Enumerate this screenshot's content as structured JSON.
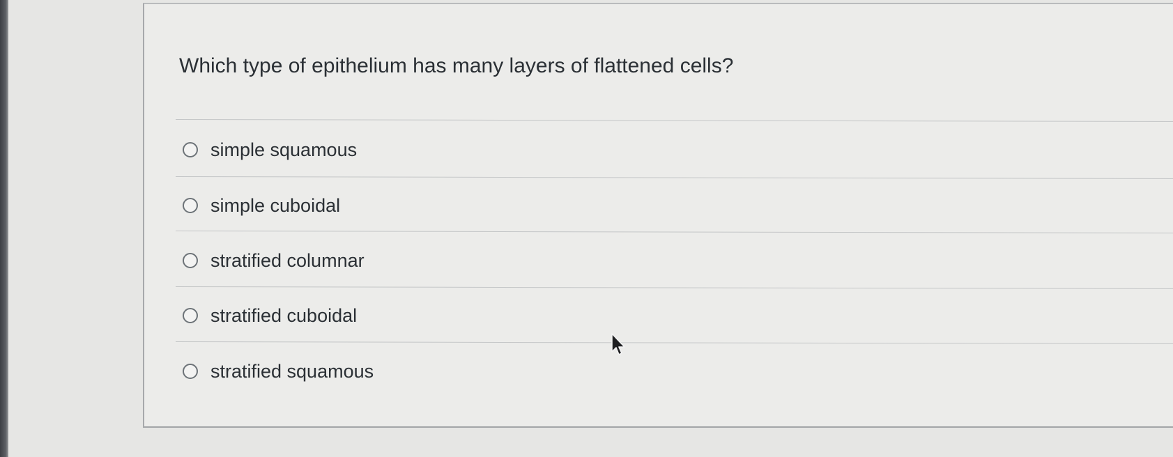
{
  "question": {
    "text": "Which type of epithelium has many layers of flattened cells?"
  },
  "answers": [
    {
      "label": "simple squamous",
      "selected": false
    },
    {
      "label": "simple cuboidal",
      "selected": false
    },
    {
      "label": "stratified columnar",
      "selected": false
    },
    {
      "label": "stratified cuboidal",
      "selected": false
    },
    {
      "label": "stratified squamous",
      "selected": false
    }
  ],
  "icons": {
    "cursor": "mouse-pointer-icon",
    "radio": "radio-button-icon"
  }
}
